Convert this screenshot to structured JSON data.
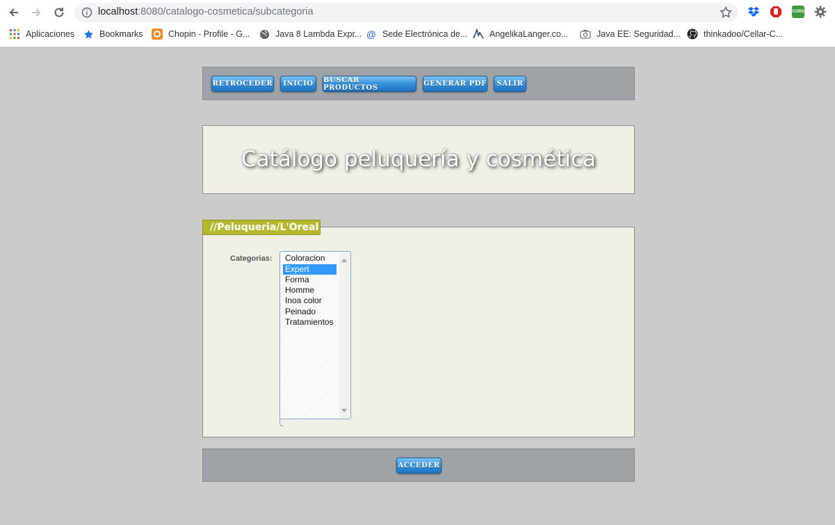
{
  "browser": {
    "url_host": "localhost",
    "url_rest": ":8080/catalogo-cosmetica/subcategoria",
    "bookmarks": [
      {
        "label": "Aplicaciones",
        "icon": "apps-grid-icon"
      },
      {
        "label": "Bookmarks",
        "icon": "star-icon"
      },
      {
        "label": "Chopin - Profile - G...",
        "icon": "chopin-icon"
      },
      {
        "label": "Java 8 Lambda Expr...",
        "icon": "globe-icon"
      },
      {
        "label": "Sede Electrónica de...",
        "icon": "at-icon"
      },
      {
        "label": "AngelikaLanger.co...",
        "icon": "angelika-icon"
      },
      {
        "label": "Java EE: Seguridad...",
        "icon": "camera-icon"
      },
      {
        "label": "thinkadoo/Cellar-C...",
        "icon": "github-icon"
      }
    ],
    "extension_cors_label": "CORS"
  },
  "toolbar": {
    "buttons": [
      "RETROCEDER",
      "INICIO",
      "BUSCAR PRODUCTOS",
      "GENERAR PDF",
      "SALIR"
    ]
  },
  "header": {
    "title": "Catálogo peluquería y cosmética"
  },
  "section": {
    "breadcrumb": "//Peluqueria/L'Oreal",
    "field_label": "Categorias:",
    "options": [
      "Coloracion",
      "Expert",
      "Forma",
      "Homme",
      "Inoa color",
      "Peinado",
      "Tratamientos"
    ],
    "selected_option": "Expert"
  },
  "footer": {
    "submit_label": "ACCEDER"
  },
  "colors": {
    "page_background": "#cbcbcb",
    "toolbar_panel": "#9fa3a7",
    "content_background": "#f0f0e6",
    "breadcrumb_tab": "#b5b82c",
    "button_blue": "#2b84d0",
    "selected_option": "#3399ff"
  }
}
